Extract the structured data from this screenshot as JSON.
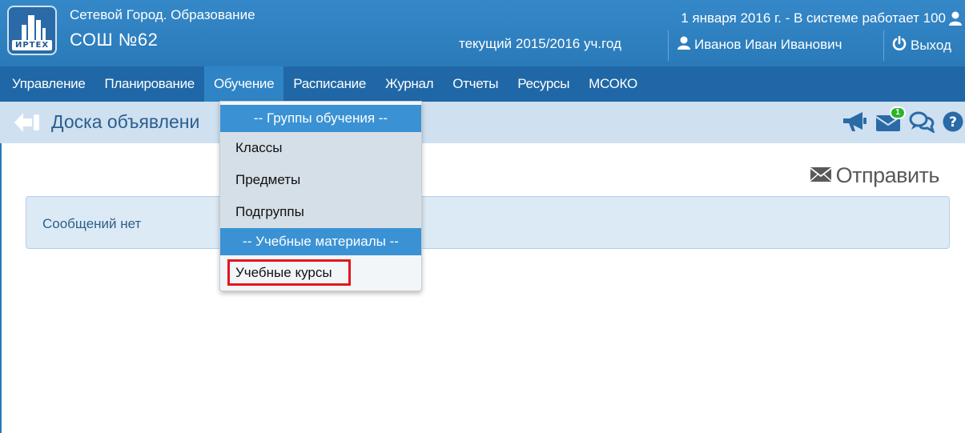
{
  "header": {
    "logo_text": "ИРТЕХ",
    "app_title": "Сетевой Город. Образование",
    "school_name": "СОШ №62",
    "date_status": "1 января 2016 г. - В системе работает 100",
    "school_year": "текущий 2015/2016 уч.год",
    "user_name": "Иванов Иван Иванович",
    "logout_label": "Выход",
    "icons": [
      "user-icon",
      "person-icon",
      "power-icon"
    ]
  },
  "nav": {
    "items": [
      {
        "label": "Управление"
      },
      {
        "label": "Планирование"
      },
      {
        "label": "Обучение",
        "active": true
      },
      {
        "label": "Расписание"
      },
      {
        "label": "Журнал"
      },
      {
        "label": "Отчеты"
      },
      {
        "label": "Ресурсы"
      },
      {
        "label": "МСОКО"
      }
    ]
  },
  "subheader": {
    "page_title": "Доска объявлени",
    "icons": [
      "back-arrow-icon",
      "megaphone-icon",
      "mail-icon",
      "chat-icon",
      "help-icon"
    ],
    "mail_badge": "1"
  },
  "main": {
    "send_label": "Отправить",
    "empty_message": "Сообщений нет"
  },
  "dropdown": {
    "group_header": "-- Группы обучения --",
    "items": [
      "Классы",
      "Предметы",
      "Подгруппы"
    ],
    "materials_header": "-- Учебные материалы --",
    "materials_items": [
      "Учебные курсы"
    ]
  },
  "colors": {
    "header_bg": "#2f7fbf",
    "nav_bg": "#1f67a6",
    "nav_active": "#2f84c6",
    "subheader_bg": "#cfe0f1",
    "dropdown_header": "#3a92d4",
    "highlight": "#e3161e",
    "badge": "#2db32d"
  }
}
